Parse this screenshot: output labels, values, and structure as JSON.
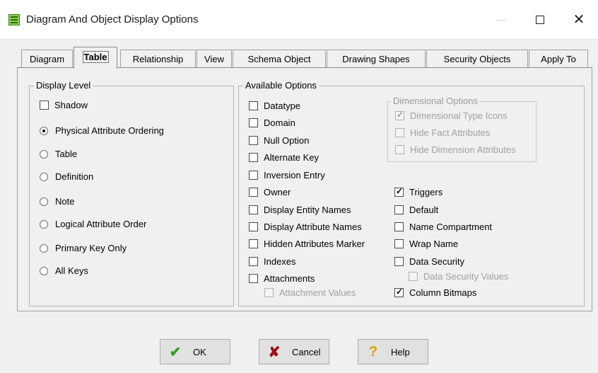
{
  "window": {
    "title": "Diagram And Object Display Options",
    "minimize_label": "—",
    "maximize_label": "",
    "close_label": "✕"
  },
  "tabs": [
    {
      "label": "Diagram",
      "active": false
    },
    {
      "label": "Table",
      "active": true
    },
    {
      "label": "Relationship",
      "active": false
    },
    {
      "label": "View",
      "active": false
    },
    {
      "label": "Schema Object",
      "active": false
    },
    {
      "label": "Drawing Shapes",
      "active": false
    },
    {
      "label": "Security Objects",
      "active": false
    },
    {
      "label": "Apply To",
      "active": false
    }
  ],
  "display_level": {
    "legend": "Display Level",
    "shadow": {
      "label": "Shadow",
      "checked": false
    },
    "radios": [
      {
        "label": "Physical Attribute Ordering",
        "selected": true
      },
      {
        "label": "Table",
        "selected": false
      },
      {
        "label": "Definition",
        "selected": false
      },
      {
        "label": "Note",
        "selected": false
      },
      {
        "label": "Logical Attribute Order",
        "selected": false
      },
      {
        "label": "Primary Key Only",
        "selected": false
      },
      {
        "label": "All Keys",
        "selected": false
      }
    ]
  },
  "available_options": {
    "legend": "Available Options",
    "left": [
      {
        "label": "Datatype",
        "checked": false
      },
      {
        "label": "Domain",
        "checked": false
      },
      {
        "label": "Null Option",
        "checked": false
      },
      {
        "label": "Alternate Key",
        "checked": false
      },
      {
        "label": "Inversion Entry",
        "checked": false
      },
      {
        "label": "Owner",
        "checked": false
      },
      {
        "label": "Display Entity Names",
        "checked": false
      },
      {
        "label": "Display Attribute Names",
        "checked": false
      },
      {
        "label": "Hidden Attributes Marker",
        "checked": false
      },
      {
        "label": "Indexes",
        "checked": false
      },
      {
        "label": "Attachments",
        "checked": false
      }
    ],
    "attachment_values": {
      "label": "Attachment Values",
      "checked": false,
      "enabled": false
    },
    "right": [
      {
        "label": "Triggers",
        "checked": true
      },
      {
        "label": "Default",
        "checked": false
      },
      {
        "label": "Name Compartment",
        "checked": false
      },
      {
        "label": "Wrap Name",
        "checked": false
      },
      {
        "label": "Data Security",
        "checked": false
      }
    ],
    "data_security_values": {
      "label": "Data Security Values",
      "checked": false,
      "enabled": false
    },
    "column_bitmaps": {
      "label": "Column Bitmaps",
      "checked": true
    }
  },
  "dimensional_options": {
    "legend": "Dimensional Options",
    "enabled": false,
    "items": [
      {
        "label": "Dimensional Type Icons",
        "checked": true
      },
      {
        "label": "Hide Fact Attributes",
        "checked": false
      },
      {
        "label": "Hide Dimension Attributes",
        "checked": false
      }
    ]
  },
  "buttons": {
    "ok": {
      "label": "OK",
      "icon": "check-icon"
    },
    "cancel": {
      "label": "Cancel",
      "icon": "cross-icon"
    },
    "help": {
      "label": "Help",
      "icon": "question-icon"
    }
  },
  "colors": {
    "ok_icon": "#3a9a2a",
    "cancel_icon": "#a01010",
    "help_icon": "#e0a000",
    "app_icon": "#8ad04a"
  }
}
